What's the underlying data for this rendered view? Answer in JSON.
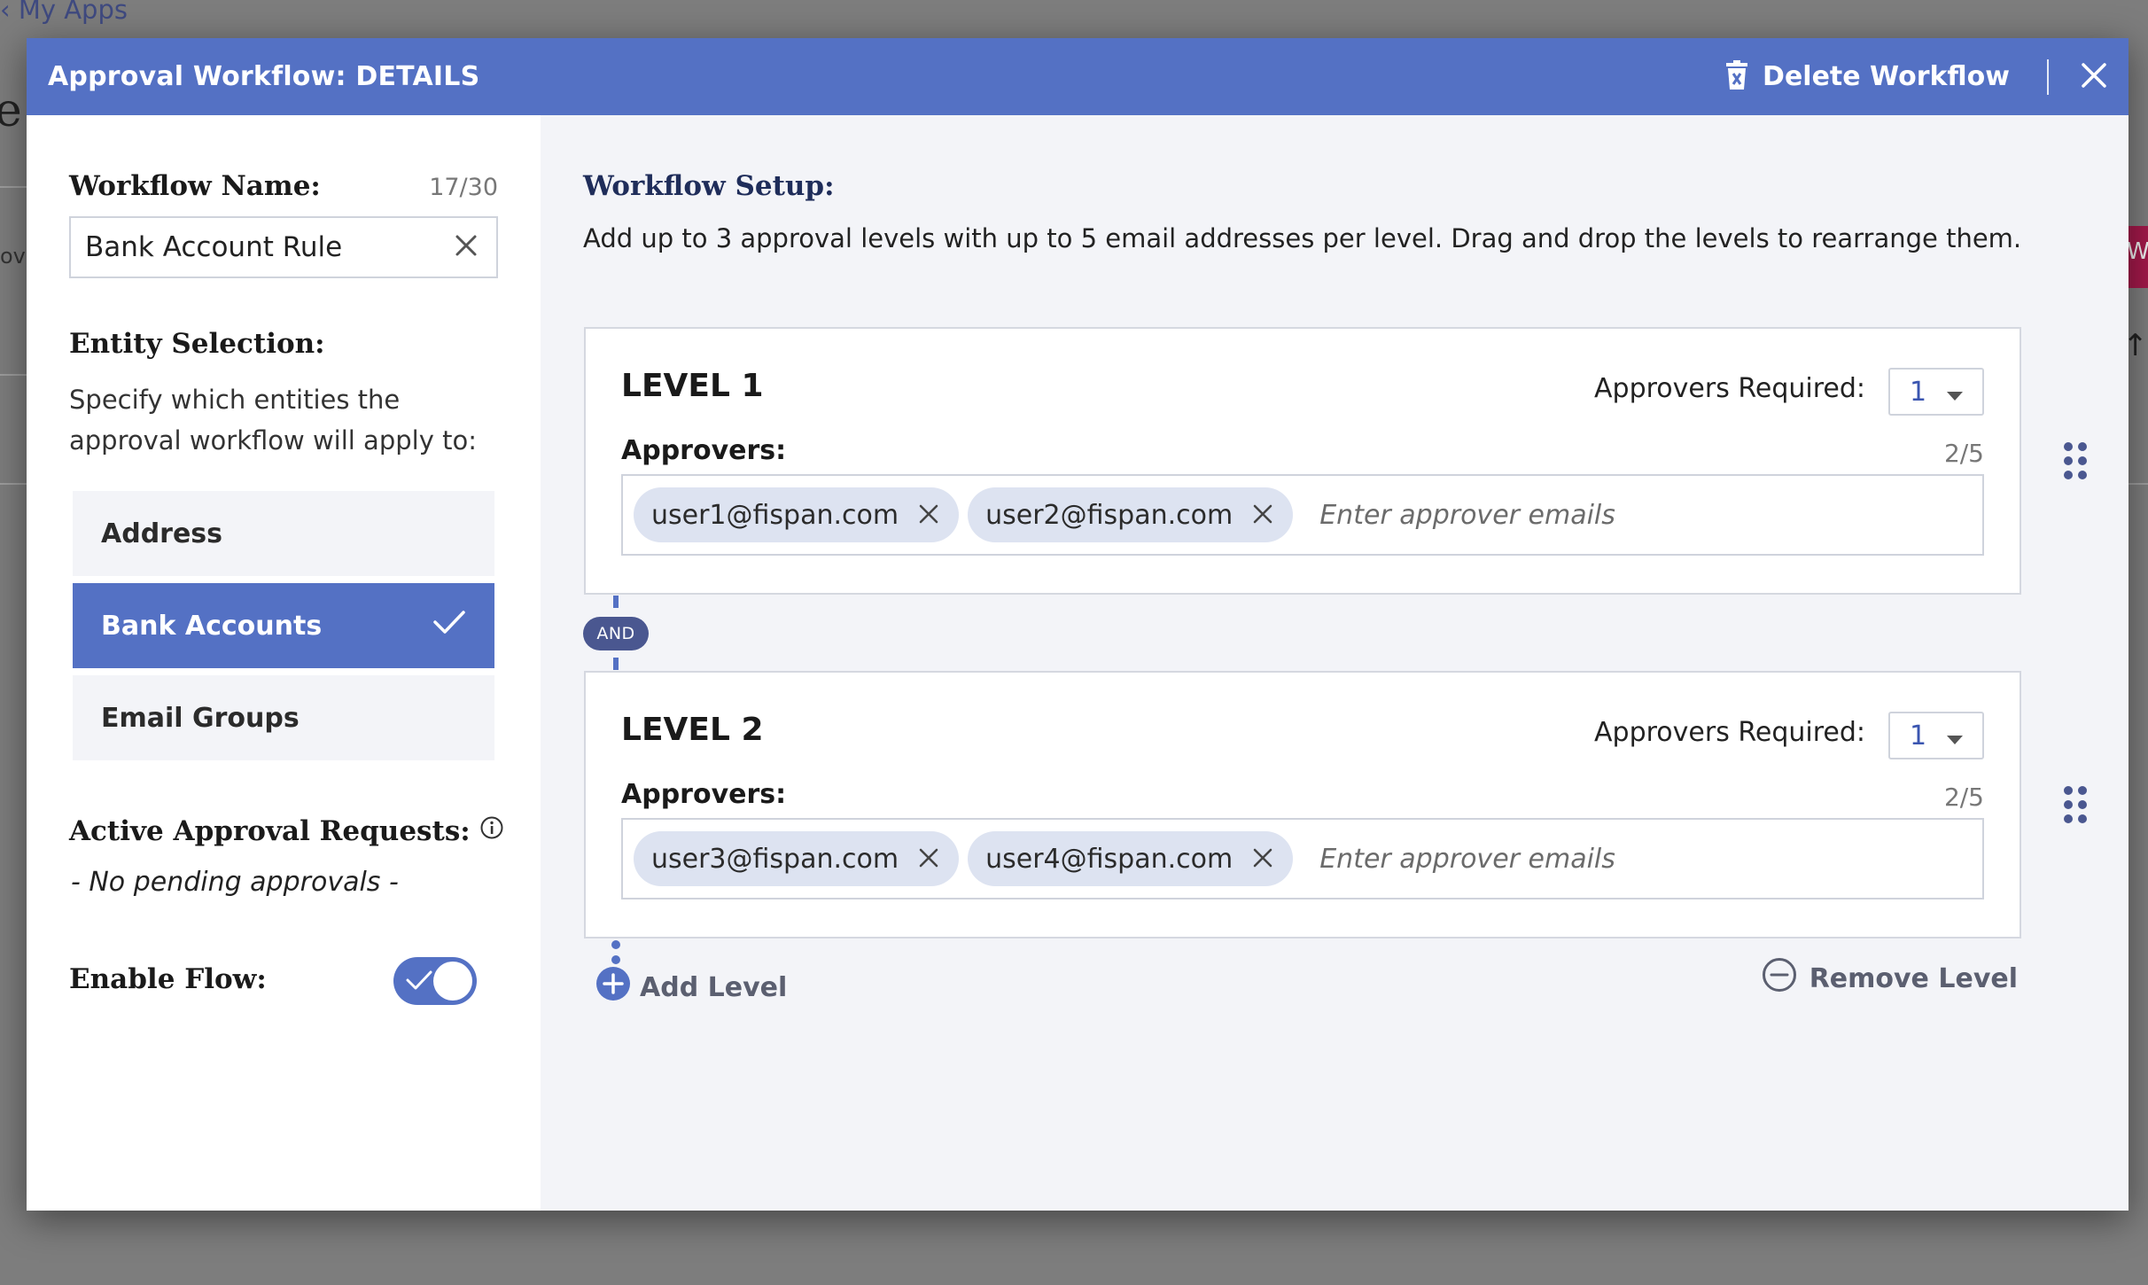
{
  "background": {
    "breadcrumb": "‹ My Apps",
    "big_letter": "e",
    "side_text": "ov",
    "chip_text": "W"
  },
  "modal": {
    "title": "Approval Workflow: DETAILS",
    "delete_label": "Delete Workflow"
  },
  "left": {
    "workflow_name_label": "Workflow Name:",
    "workflow_name_counter": "17/30",
    "workflow_name_value": "Bank Account Rule",
    "entity_title": "Entity Selection:",
    "entity_desc": "Specify which entities the approval workflow will apply to:",
    "entities": [
      {
        "label": "Address",
        "selected": false
      },
      {
        "label": "Bank Accounts",
        "selected": true
      },
      {
        "label": "Email Groups",
        "selected": false
      }
    ],
    "active_title": "Active Approval Requests:",
    "no_pending": "- No pending approvals -",
    "enable_label": "Enable Flow:",
    "enable_on": true
  },
  "right": {
    "setup_title": "Workflow Setup:",
    "setup_desc": "Add up to 3 approval levels with up to 5 email addresses per level. Drag and drop the levels to rearrange them.",
    "levels": [
      {
        "title": "LEVEL 1",
        "req_label": "Approvers Required:",
        "req_value": "1",
        "approvers_label": "Approvers:",
        "count": "2/5",
        "emails": [
          "user1@fispan.com",
          "user2@fispan.com"
        ],
        "placeholder": "Enter approver emails"
      },
      {
        "title": "LEVEL 2",
        "req_label": "Approvers Required:",
        "req_value": "1",
        "approvers_label": "Approvers:",
        "count": "2/5",
        "emails": [
          "user3@fispan.com",
          "user4@fispan.com"
        ],
        "placeholder": "Enter approver emails"
      }
    ],
    "and_label": "AND",
    "add_level": "Add Level",
    "remove_level": "Remove Level"
  },
  "colors": {
    "accent": "#5471c4",
    "and_pill": "#4a5790",
    "chip": "#dde3f1",
    "right_pane_bg": "#f3f4f8"
  }
}
